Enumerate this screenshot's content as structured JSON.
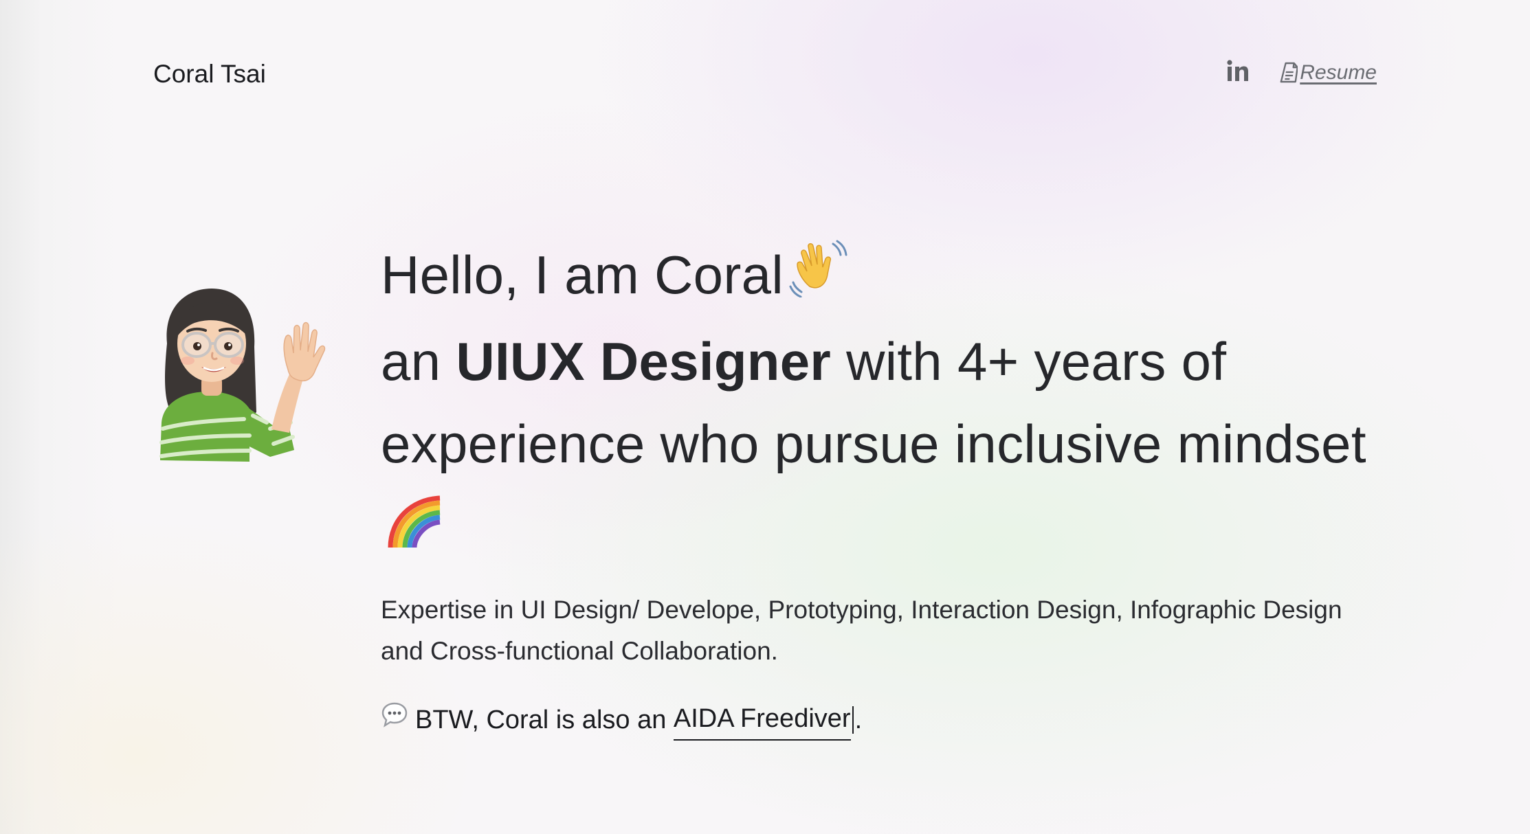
{
  "header": {
    "site_name": "Coral Tsai",
    "resume_label": "Resume",
    "linkedin_icon": "linkedin-icon",
    "resume_icon": "document-icon"
  },
  "hero": {
    "line1": "Hello, I am Coral",
    "wave_emoji": "waving-hand-icon",
    "an": "an",
    "role": "UIUX Designer",
    "rest": "with 4+ years of experience who pursue inclusive mindset",
    "rainbow_emoji": "rainbow-icon",
    "expertise": "Expertise in UI Design/ Develope, Prototyping, Interaction Design, Infographic Design and Cross-functional Collaboration.",
    "btw_prefix": "BTW, Coral is also an",
    "btw_link": "AIDA Freediver",
    "btw_suffix": "."
  },
  "colors": {
    "text": "#1f2024",
    "muted_link": "#6a6c72",
    "shirt_green": "#6cae3e"
  }
}
